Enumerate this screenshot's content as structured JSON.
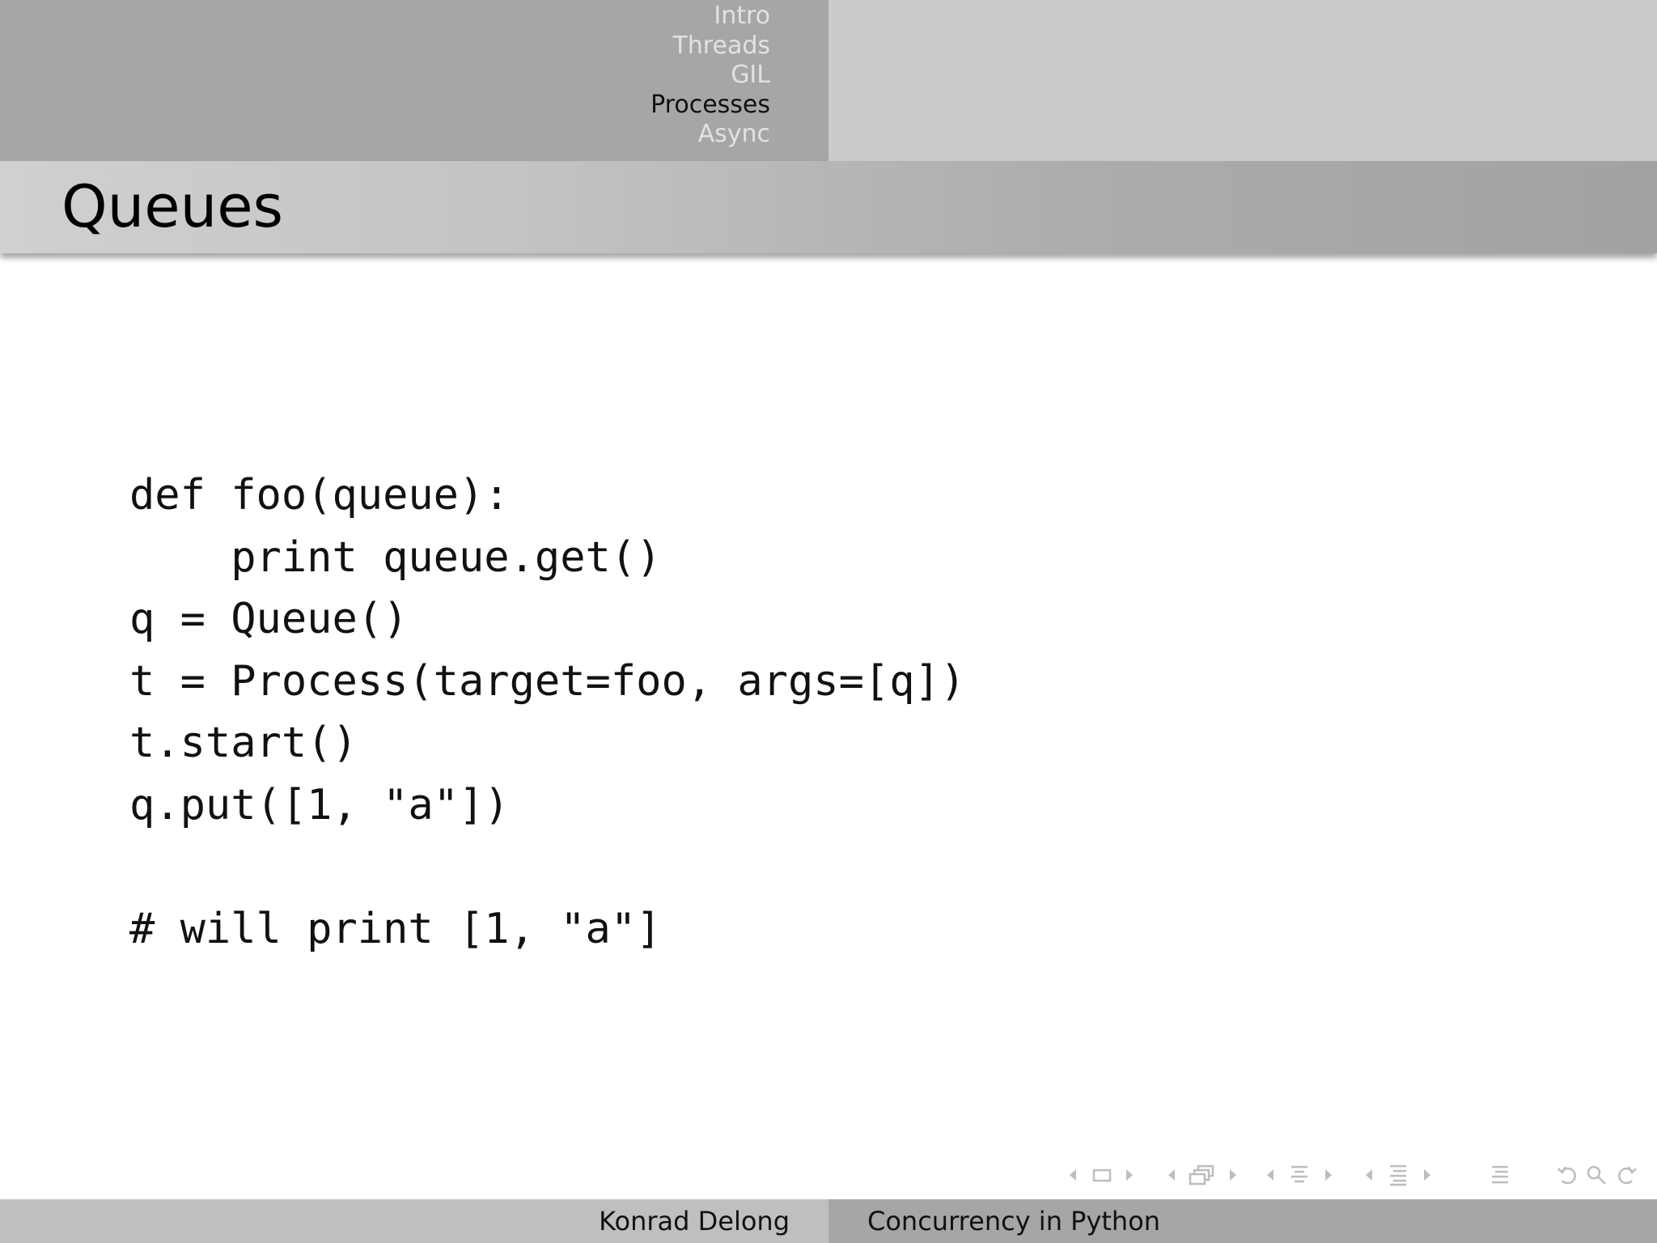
{
  "header": {
    "sections": [
      {
        "label": "Intro",
        "active": false
      },
      {
        "label": "Threads",
        "active": false
      },
      {
        "label": "GIL",
        "active": false
      },
      {
        "label": "Processes",
        "active": true
      },
      {
        "label": "Async",
        "active": false
      }
    ]
  },
  "slide": {
    "title": "Queues",
    "code_lines": [
      "def foo(queue):",
      "    print queue.get()",
      "q = Queue()",
      "t = Process(target=foo, args=[q])",
      "t.start()",
      "q.put([1, \"a\"])",
      "",
      "# will print [1, \"a\"]"
    ]
  },
  "footer": {
    "author": "Konrad Delong",
    "talk_title": "Concurrency in Python"
  },
  "navigation_icons": [
    "prev-arrow-icon",
    "frame-icon",
    "next-arrow-icon",
    "prev-arrow-icon",
    "subsection-icon",
    "next-arrow-icon",
    "prev-arrow-icon",
    "section-icon",
    "next-arrow-icon",
    "prev-arrow-icon",
    "document-icon",
    "next-arrow-icon",
    "outline-icon",
    "undo-icon",
    "search-icon",
    "redo-icon"
  ],
  "colors": {
    "header_left": "#a6a6a6",
    "header_right": "#cbcbcb",
    "nav_inactive": "#e2e2e2",
    "nav_active": "#111111",
    "footer_left": "#bfbfbf",
    "footer_right": "#a6a6a6"
  }
}
